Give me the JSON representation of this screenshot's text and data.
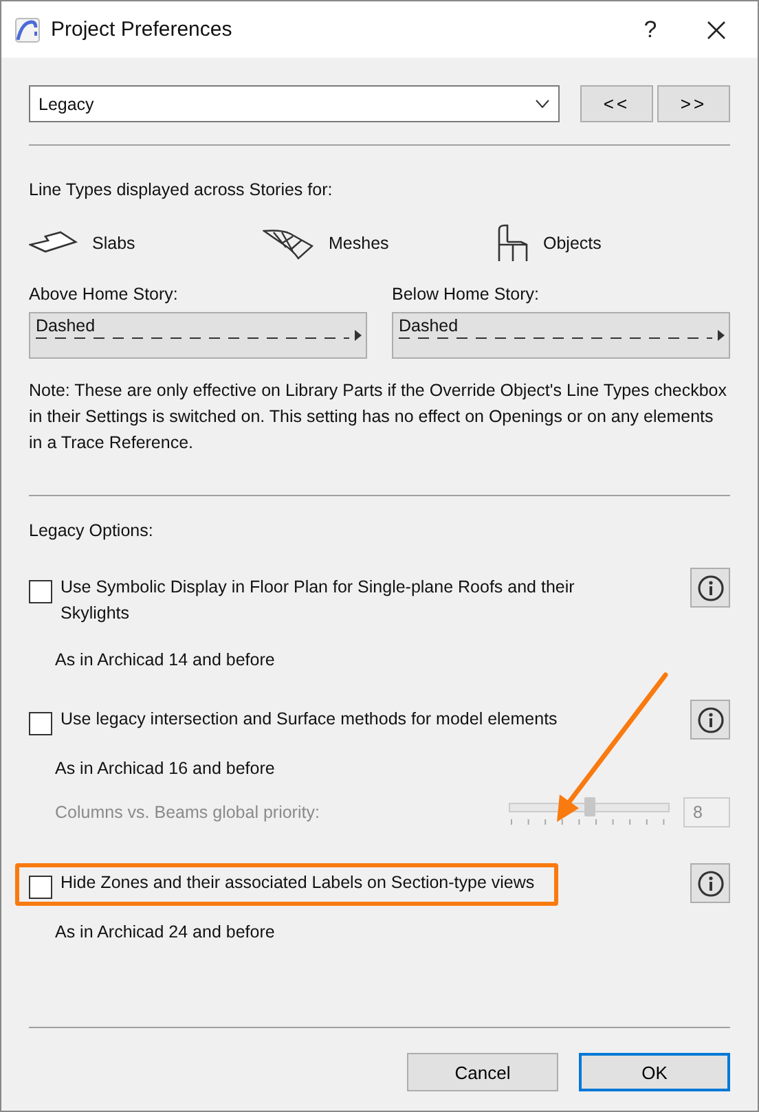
{
  "window": {
    "title": "Project Preferences",
    "help": "?"
  },
  "dropdown": {
    "value": "Legacy"
  },
  "nav_buttons": [
    "<<",
    ">>"
  ],
  "line_types": {
    "heading": "Line Types displayed across Stories for:",
    "elements": [
      {
        "kind": "slab",
        "label": "Slabs"
      },
      {
        "kind": "mesh",
        "label": "Meshes"
      },
      {
        "kind": "object",
        "label": "Objects"
      }
    ],
    "pickers": [
      {
        "label": "Above Home Story:",
        "value": "Dashed"
      },
      {
        "label": "Below Home Story:",
        "value": "Dashed"
      }
    ],
    "note": "Note: These are only effective on Library Parts if the Override Object's Line Types checkbox in their Settings is switched on. This setting has no effect on Openings or on any elements in a Trace Reference."
  },
  "legacy": {
    "heading": "Legacy Options:",
    "options": [
      {
        "kind": "checkbox",
        "label": "Use Symbolic Display in Floor Plan for Single-plane Roofs and their Skylights",
        "checked": false,
        "highlighted": false,
        "note": "As in Archicad 14 and before"
      },
      {
        "kind": "checkbox",
        "label": "Use legacy intersection and Surface methods for model elements",
        "checked": false,
        "highlighted": false,
        "note": "As in Archicad 16 and before"
      },
      {
        "kind": "slider",
        "label": "Columns vs. Beams global priority:",
        "disabled": true,
        "level": 0.5,
        "value": "8"
      },
      {
        "kind": "checkbox",
        "label": "Hide Zones and their associated Labels on Section-type views",
        "checked": false,
        "highlighted": true,
        "note": "As in Archicad 24 and before"
      }
    ]
  },
  "buttons": [
    {
      "label": "Cancel",
      "default": false
    },
    {
      "label": "OK",
      "default": true
    }
  ]
}
